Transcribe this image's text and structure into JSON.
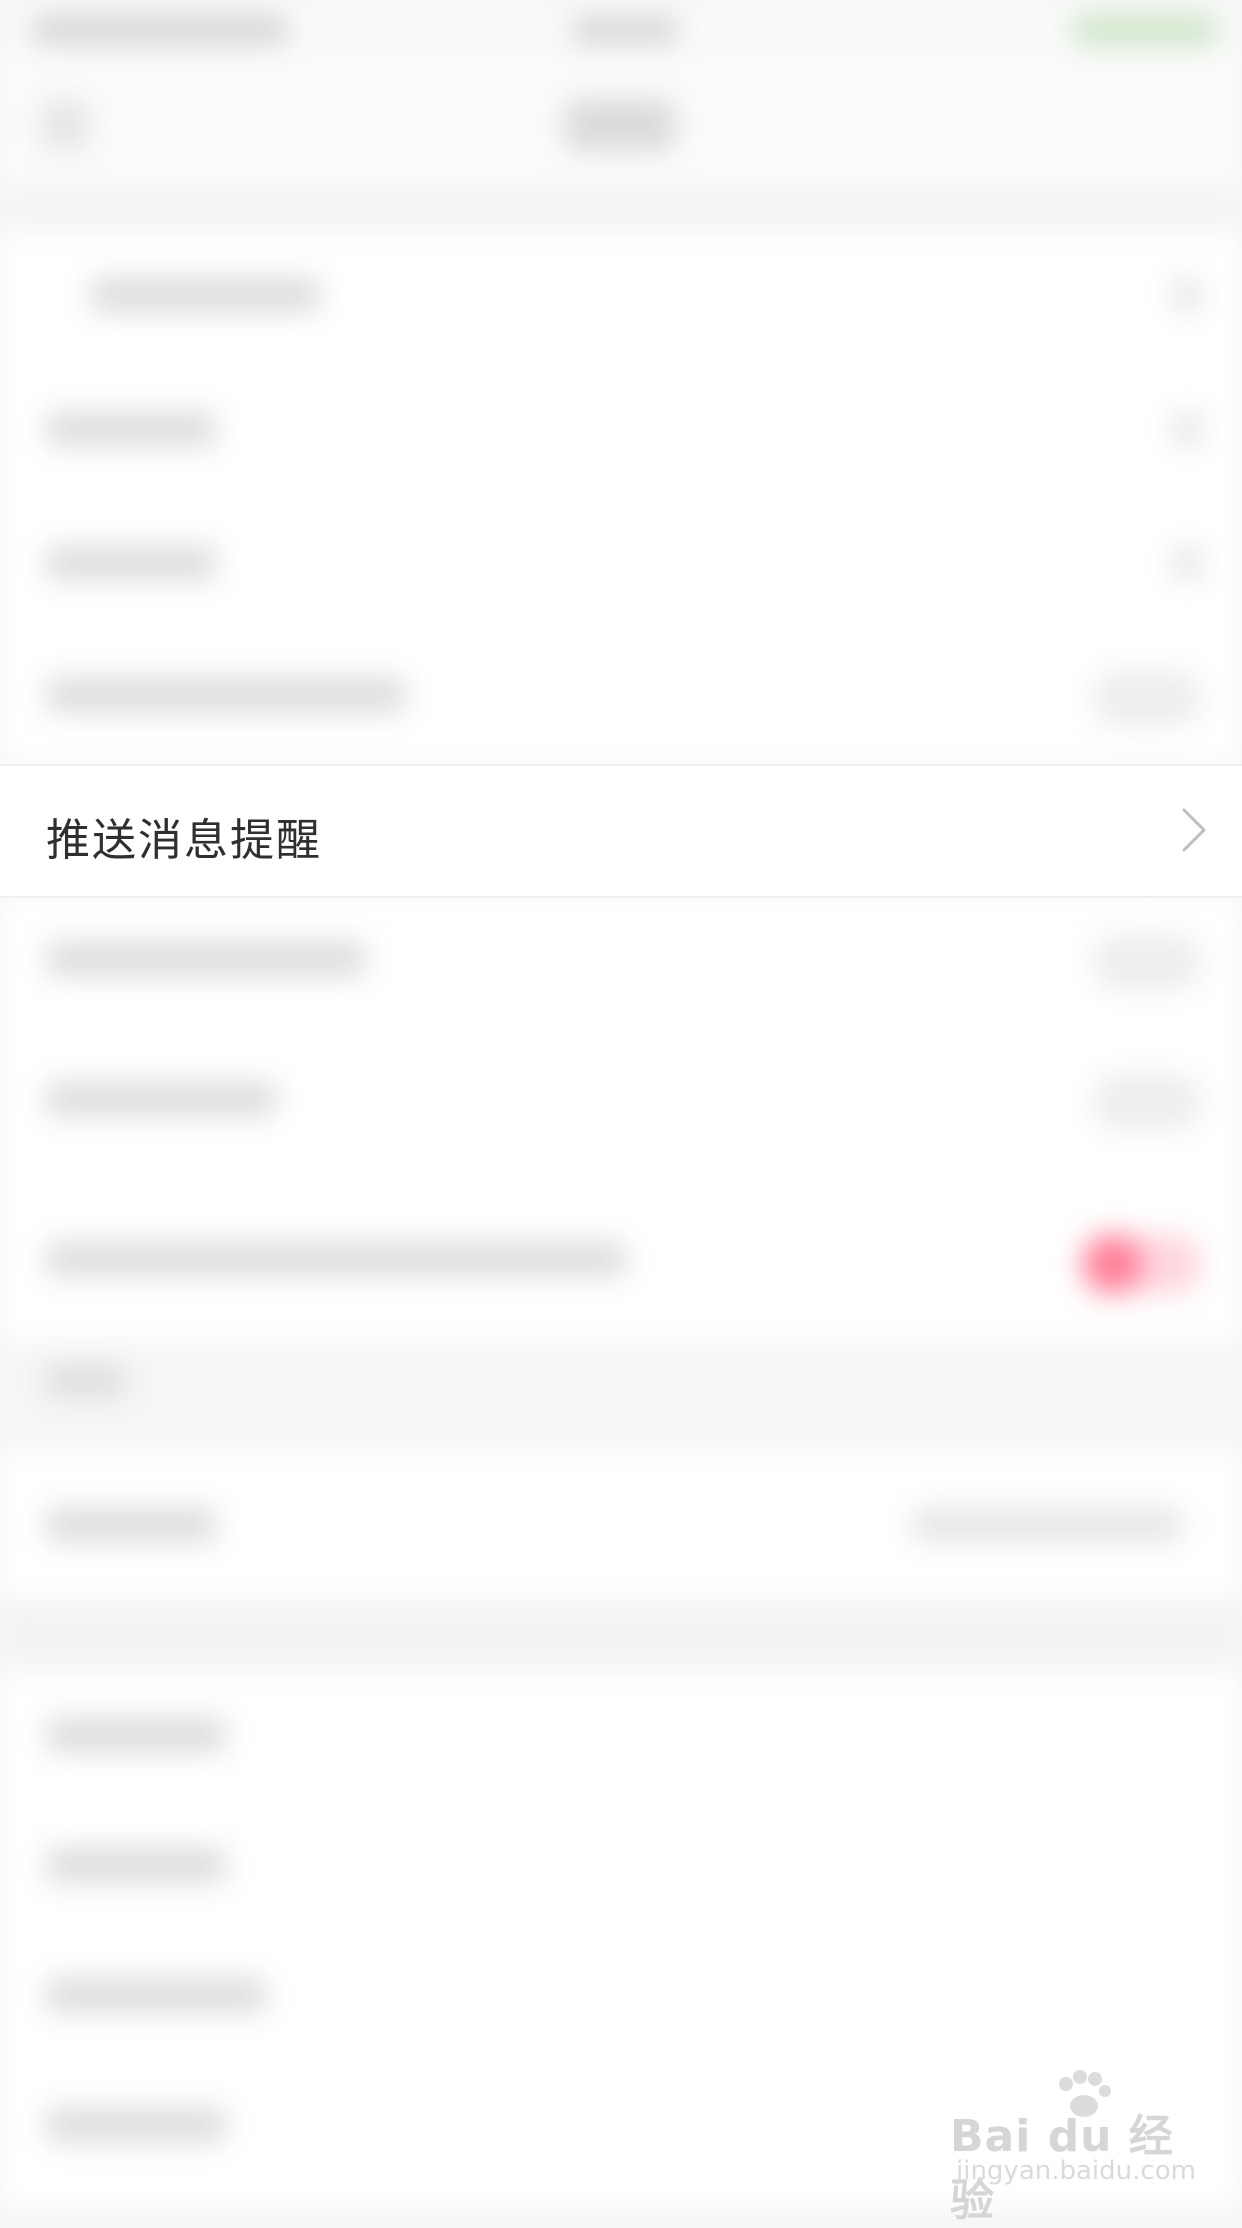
{
  "settings": {
    "push_reminder_label": "推送消息提醒"
  },
  "watermark": {
    "brand": "Bai du 经验",
    "url": "jingyan.baidu.com"
  },
  "icons": {
    "chevron": "chevron-right-icon",
    "watermark_logo": "paw-icon"
  },
  "colors": {
    "accent_toggle": "#ff7f98",
    "background": "#f6f6f6"
  }
}
